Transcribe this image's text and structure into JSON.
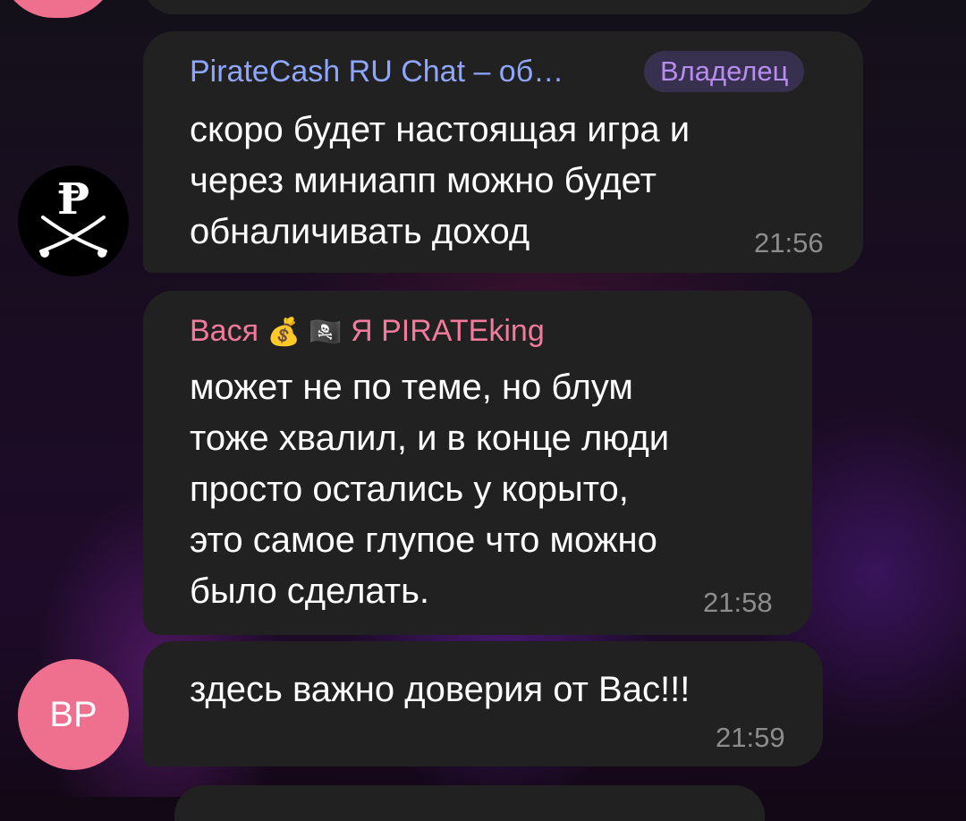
{
  "messages": [
    {
      "sender": "PirateCash RU Chat – об…",
      "sender_color": "#8ea6ff",
      "badge": "Владелец",
      "text": "скоро будет настоящая игра и\nчерез миниапп можно будет\nобналичивать доход",
      "time": "21:56",
      "avatar_letter": "Ᵽ"
    },
    {
      "sender_name": "Вася",
      "sender_emoji_1": "💰",
      "sender_emoji_2": "🏴‍☠️",
      "sender_rest": "Я PIRATEking",
      "sender_color": "#f27a9c",
      "text": "может не по теме, но блум\nтоже хвалил, и в конце люди\nпросто остались у корыто,\nэто самое глупое что можно\nбыло сделать.",
      "time": "21:58"
    },
    {
      "text": "здесь важно доверия от Вас!!!",
      "time": "21:59",
      "avatar_initials": "BP",
      "avatar_color": "#ef6f8f"
    }
  ]
}
